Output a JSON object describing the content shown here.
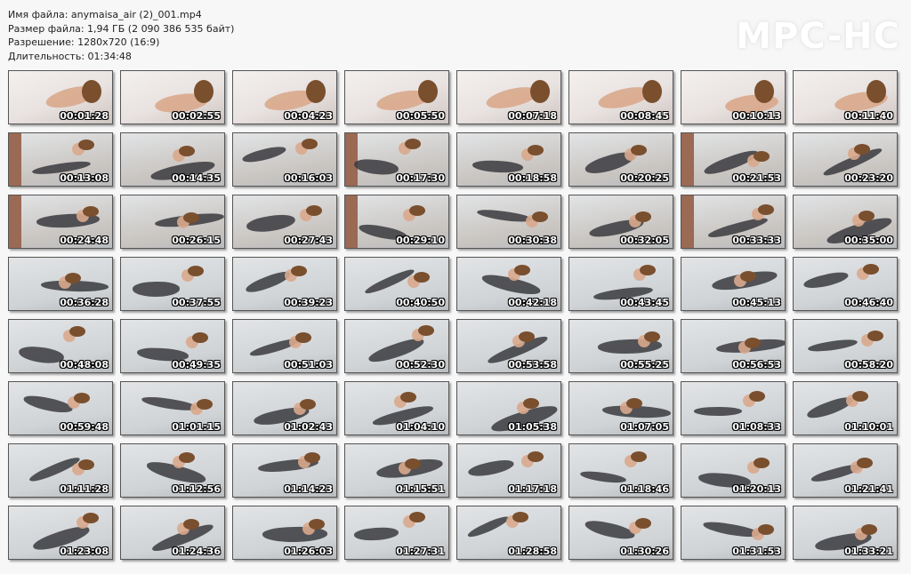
{
  "header": {
    "filename": "Имя файла: anymaisa_air (2)_001.mp4",
    "filesize": "Размер файла: 1,94 ГБ (2 090 386 535 байт)",
    "resolution": "Разрешение: 1280x720 (16:9)",
    "duration": "Длительность: 01:34:48"
  },
  "logo": "MPC-HC",
  "thumbnails": [
    "00:01:28",
    "00:02:55",
    "00:04:23",
    "00:05:50",
    "00:07:18",
    "00:08:45",
    "00:10:13",
    "00:11:40",
    "00:13:08",
    "00:14:35",
    "00:16:03",
    "00:17:30",
    "00:18:58",
    "00:20:25",
    "00:21:53",
    "00:23:20",
    "00:24:48",
    "00:26:15",
    "00:27:43",
    "00:29:10",
    "00:30:38",
    "00:32:05",
    "00:33:33",
    "00:35:00",
    "00:36:28",
    "00:37:55",
    "00:39:23",
    "00:40:50",
    "00:42:18",
    "00:43:45",
    "00:45:13",
    "00:46:40",
    "00:48:08",
    "00:49:35",
    "00:51:03",
    "00:52:30",
    "00:53:58",
    "00:55:25",
    "00:56:53",
    "00:58:20",
    "00:59:48",
    "01:01:15",
    "01:02:43",
    "01:04:10",
    "01:05:38",
    "01:07:05",
    "01:08:33",
    "01:10:01",
    "01:11:28",
    "01:12:56",
    "01:14:23",
    "01:15:51",
    "01:17:18",
    "01:18:46",
    "01:20:13",
    "01:21:41",
    "01:23:08",
    "01:24:36",
    "01:26:03",
    "01:27:31",
    "01:28:58",
    "01:30:26",
    "01:31:53",
    "01:33:21"
  ],
  "colors": {
    "row1_bg": "#e8e2e0",
    "bed_bg": "#cfd3d6",
    "wall": "#9a6a55",
    "stockings": "#3a3a3e",
    "skin": "#d9a98c",
    "hair": "#7a4f2e"
  }
}
